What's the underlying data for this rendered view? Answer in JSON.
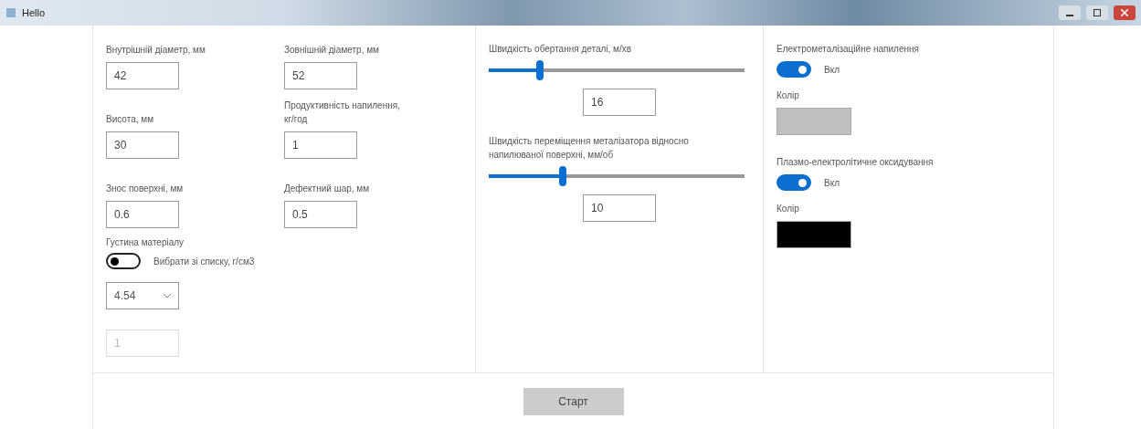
{
  "window": {
    "title": "Hello"
  },
  "fields": [
    {
      "label": "Внутрішній діаметр, мм",
      "value": "42"
    },
    {
      "label": "Висота, мм",
      "value": "30"
    },
    {
      "label": "Знос поверхні, мм",
      "value": "0.6"
    },
    {
      "label": "Зовнішній діаметр, мм",
      "value": "52"
    },
    {
      "label": "Продуктивність напилення, кг/год",
      "value": "1"
    },
    {
      "label": "Дефектний шар, мм",
      "value": "0.5"
    }
  ],
  "density": {
    "label": "Густина матеріалу",
    "toggle": {
      "on": false,
      "label": "Вибрати зі списку, г/см3"
    },
    "select": {
      "value": "4.54",
      "disabled": false
    },
    "input": {
      "value": "1",
      "disabled": true
    }
  },
  "sliders": [
    {
      "label": "Швидкість обертання деталі, м/хв",
      "level": 0.2,
      "value": "16"
    },
    {
      "label": "Швидкість переміщення металізатора відносно напилюваної поверхні, мм/об",
      "level": 0.29,
      "value": "10"
    }
  ],
  "coatings": [
    {
      "label": "Електрометалізаційне напилення",
      "on": true,
      "state_label": "Вкл",
      "color_label": "Колір",
      "color": "#c0c0c0"
    },
    {
      "label": "Плазмо-електролітичне оксидування",
      "on": true,
      "state_label": "Вкл",
      "color_label": "Колір",
      "color": "#000000"
    }
  ],
  "start_button": "Старт"
}
